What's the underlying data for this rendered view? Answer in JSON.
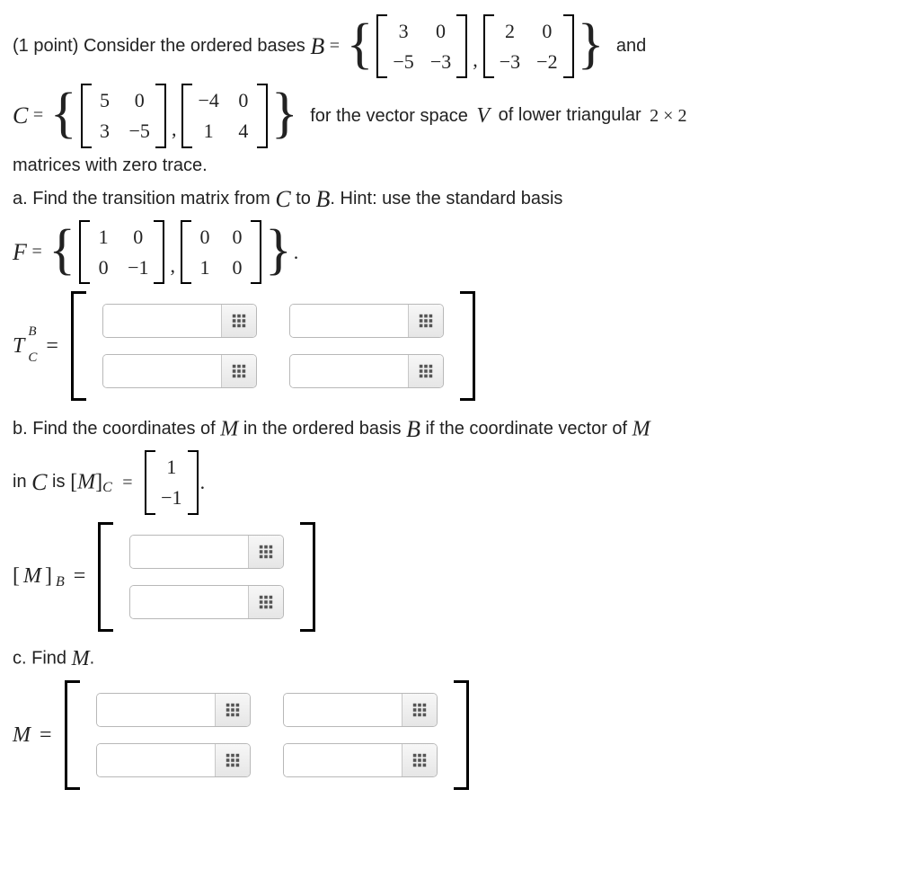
{
  "intro": {
    "points": "(1 point)",
    "lead": "Consider the ordered bases",
    "and": "and",
    "for_text": "for the vector space",
    "space_desc_a": "of lower triangular",
    "dim": "2 × 2",
    "space_desc_b": "matrices with zero trace."
  },
  "labels": {
    "B": "B",
    "C": "C",
    "F": "F",
    "V": "V",
    "M": "M",
    "eq": "="
  },
  "B": {
    "m1": [
      "3",
      "0",
      "−5",
      "−3"
    ],
    "m2": [
      "2",
      "0",
      "−3",
      "−2"
    ]
  },
  "C": {
    "m1": [
      "5",
      "0",
      "3",
      "−5"
    ],
    "m2": [
      "−4",
      "0",
      "1",
      "4"
    ]
  },
  "F": {
    "m1": [
      "1",
      "0",
      "0",
      "−1"
    ],
    "m2": [
      "0",
      "0",
      "1",
      "0"
    ]
  },
  "part_a": {
    "text1": "a. Find the transition matrix from",
    "text2": "to",
    "text3": ". Hint: use the standard basis",
    "period": ".",
    "T_label": "T",
    "T_sup": "B",
    "T_sub": "C"
  },
  "part_b": {
    "text1": "b. Find the coordinates of",
    "text2": "in the ordered basis",
    "text3": "if the coordinate vector of",
    "text4": "in",
    "text5": "is",
    "vec": [
      "1",
      "−1"
    ],
    "period": ".",
    "lhs_open": "[",
    "lhs_close": "]",
    "lhs_sub_B": "B",
    "lhs_sub_C": "C"
  },
  "part_c": {
    "text": "c. Find",
    "period": "."
  }
}
